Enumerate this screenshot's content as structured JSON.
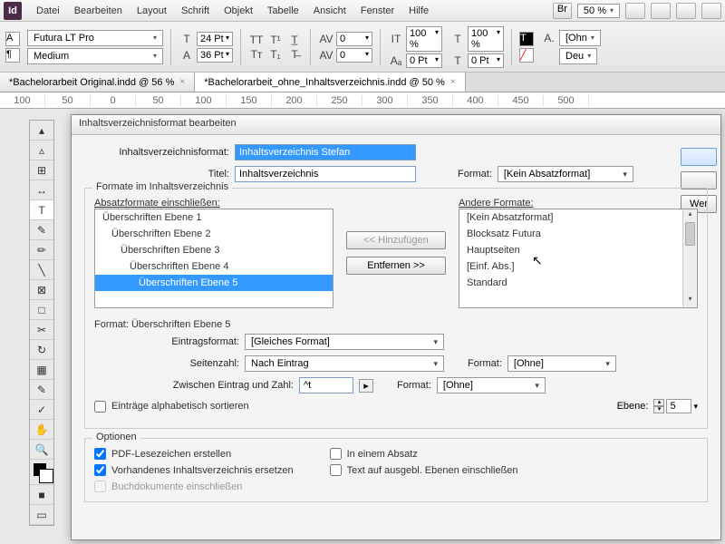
{
  "menu": {
    "items": [
      "Datei",
      "Bearbeiten",
      "Layout",
      "Schrift",
      "Objekt",
      "Tabelle",
      "Ansicht",
      "Fenster",
      "Hilfe"
    ],
    "zoom": "50 %",
    "br": "Br"
  },
  "ctrl": {
    "font": "Futura LT Pro",
    "weight": "Medium",
    "size": "24 Pt",
    "leading": "36 Pt",
    "opt1": "0",
    "opt2": "0",
    "w1": "100 %",
    "w2": "100 %",
    "h1": "0 Pt",
    "h2": "0 Pt",
    "lang": "Deu"
  },
  "tabs": [
    {
      "label": "*Bachelorarbeit Original.indd @ 56 %",
      "active": false
    },
    {
      "label": "*Bachelorarbeit_ohne_Inhaltsverzeichnis.indd @ 50 %",
      "active": true
    }
  ],
  "ruler": [
    "100",
    "50",
    "0",
    "50",
    "100",
    "150",
    "200",
    "250",
    "300",
    "350",
    "400",
    "450",
    "500"
  ],
  "dialog": {
    "title": "Inhaltsverzeichnisformat bearbeiten",
    "fmt_label": "Inhaltsverzeichnisformat:",
    "fmt_value": "Inhaltsverzeichnis Stefan",
    "title_label": "Titel:",
    "title_value": "Inhaltsverzeichnis",
    "format_label": "Format:",
    "format_value": "[Kein Absatzformat]",
    "group1": "Formate im Inhaltsverzeichnis",
    "include_label": "Absatzformate einschließen:",
    "other_label": "Andere Formate:",
    "include_list": [
      {
        "t": "Überschriften Ebene 1",
        "indent": 0
      },
      {
        "t": "Überschriften Ebene 2",
        "indent": 1
      },
      {
        "t": "Überschriften Ebene 3",
        "indent": 2
      },
      {
        "t": "Überschriften Ebene 4",
        "indent": 3
      },
      {
        "t": "Überschriften Ebene 5",
        "indent": 4,
        "selected": true
      }
    ],
    "other_list": [
      "[Kein Absatzformat]",
      "Blocksatz Futura",
      "Hauptseiten",
      "[Einf. Abs.]",
      "Standard"
    ],
    "btn_add": "<< Hinzufügen",
    "btn_remove": "Entfernen >>",
    "detail_label": "Format: Überschriften Ebene 5",
    "entry_fmt_label": "Eintragsformat:",
    "entry_fmt_value": "[Gleiches Format]",
    "page_label": "Seitenzahl:",
    "page_value": "Nach Eintrag",
    "between_label": "Zwischen Eintrag und Zahl:",
    "between_value": "^t",
    "fmt2_label": "Format:",
    "fmt2_value": "[Ohne]",
    "level_label": "Ebene:",
    "level_value": "5",
    "alpha_label": "Einträge alphabetisch sortieren",
    "group2": "Optionen",
    "opt_pdf": "PDF-Lesezeichen erstellen",
    "opt_replace": "Vorhandenes Inhaltsverzeichnis ersetzen",
    "opt_book": "Buchdokumente einschließen",
    "opt_para": "In einem Absatz",
    "opt_hidden": "Text auf ausgebl. Ebenen einschließen",
    "side_less": "Wer"
  }
}
